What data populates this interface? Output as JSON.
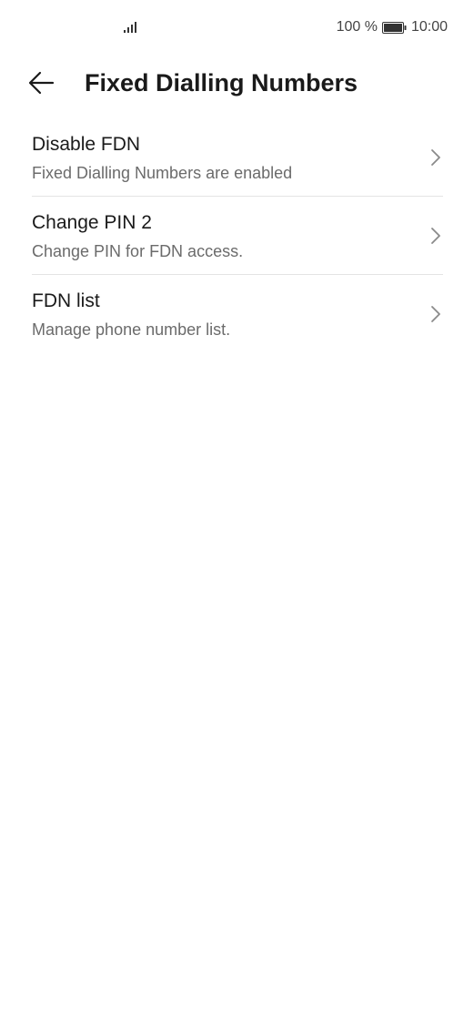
{
  "status_bar": {
    "battery_percent": "100 %",
    "time": "10:00",
    "icons": [
      "signal-icon",
      "battery-icon"
    ]
  },
  "header": {
    "back_icon": "arrow-left-icon",
    "title": "Fixed Dialling Numbers"
  },
  "settings": {
    "items": [
      {
        "title": "Disable FDN",
        "subtitle": "Fixed Dialling Numbers are enabled",
        "icon": "chevron-right-icon"
      },
      {
        "title": "Change PIN 2",
        "subtitle": "Change PIN for FDN access.",
        "icon": "chevron-right-icon"
      },
      {
        "title": "FDN list",
        "subtitle": "Manage phone number list.",
        "icon": "chevron-right-icon"
      }
    ]
  },
  "colors": {
    "background": "#ffffff",
    "primary_text": "#1a1a1a",
    "secondary_text": "#6b6b6b",
    "divider": "#e4e4e4"
  }
}
